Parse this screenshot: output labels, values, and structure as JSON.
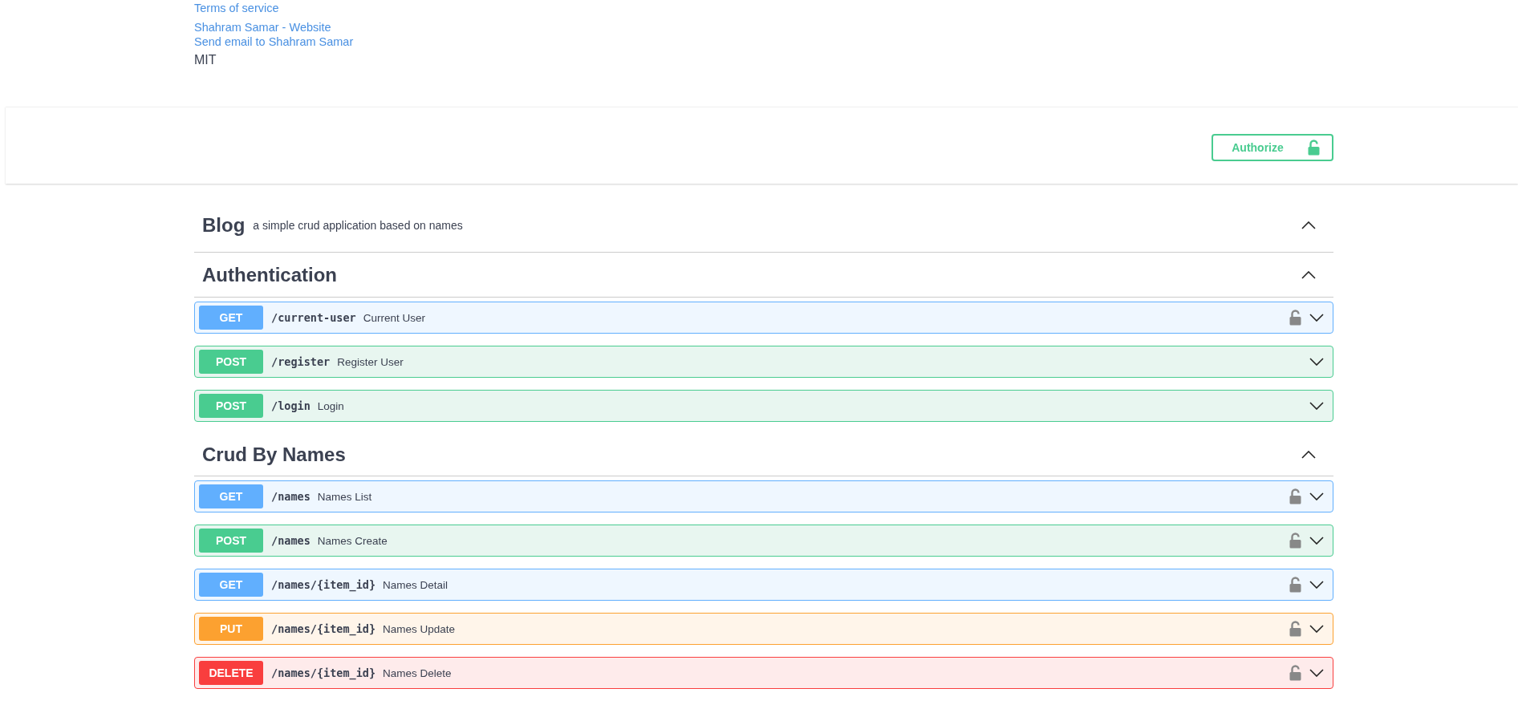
{
  "info_links": [
    {
      "text": "Terms of service"
    },
    {
      "text": "Shahram Samar - Website"
    },
    {
      "text": "Send email to Shahram Samar"
    }
  ],
  "license": "MIT",
  "authorize_button": {
    "label": "Authorize",
    "locked": false
  },
  "tags": [
    {
      "name": "Blog",
      "description": "a simple crud application based on names",
      "expanded": true
    },
    {
      "name": "Authentication",
      "expanded": true,
      "operations": [
        {
          "kind": "get",
          "method": "GET",
          "path": "/current-user",
          "summary": "Current User",
          "secured": true,
          "expanded": false
        },
        {
          "kind": "post",
          "method": "POST",
          "path": "/register",
          "summary": "Register User",
          "secured": false,
          "expanded": false
        },
        {
          "kind": "post",
          "method": "POST",
          "path": "/login",
          "summary": "Login",
          "secured": false,
          "expanded": false
        }
      ]
    },
    {
      "name": "Crud By Names",
      "expanded": true,
      "operations": [
        {
          "kind": "get",
          "method": "GET",
          "path": "/names",
          "summary": "Names List",
          "secured": true,
          "expanded": false
        },
        {
          "kind": "post",
          "method": "POST",
          "path": "/names",
          "summary": "Names Create",
          "secured": true,
          "expanded": false
        },
        {
          "kind": "get",
          "method": "GET",
          "path": "/names/{item_id}",
          "summary": "Names Detail",
          "secured": true,
          "expanded": false
        },
        {
          "kind": "put",
          "method": "PUT",
          "path": "/names/{item_id}",
          "summary": "Names Update",
          "secured": true,
          "expanded": false
        },
        {
          "kind": "delete",
          "method": "DELETE",
          "path": "/names/{item_id}",
          "summary": "Names Delete",
          "secured": true,
          "expanded": false
        }
      ]
    }
  ]
}
